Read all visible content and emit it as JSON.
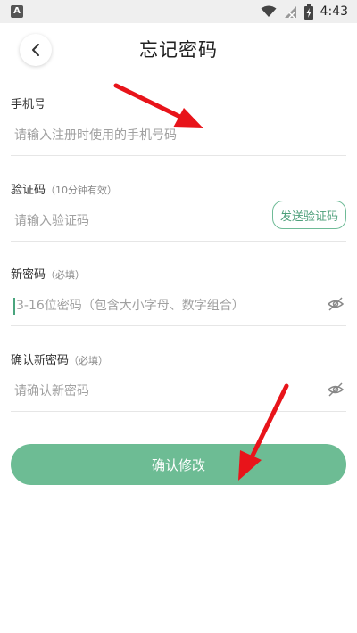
{
  "status_bar": {
    "app_icon_letter": "A",
    "time": "4:43",
    "icons": [
      "wifi-icon",
      "signal-off-icon",
      "battery-charging-icon"
    ]
  },
  "header": {
    "title": "忘记密码",
    "back_icon": "chevron-left-icon"
  },
  "form": {
    "phone": {
      "label": "手机号",
      "placeholder": "请输入注册时使用的手机号码"
    },
    "code": {
      "label": "验证码",
      "hint": "（10分钟有效）",
      "placeholder": "请输入验证码",
      "send_label": "发送验证码"
    },
    "new_password": {
      "label": "新密码",
      "hint": "（必填）",
      "placeholder": "3-16位密码（包含大小字母、数字组合）",
      "toggle_icon": "eye-off-icon"
    },
    "confirm_password": {
      "label": "确认新密码",
      "hint": "（必填）",
      "placeholder": "请确认新密码",
      "toggle_icon": "eye-off-icon"
    },
    "submit_label": "确认修改"
  },
  "colors": {
    "accent": "#6dbc94",
    "accent_text": "#4d9f7a",
    "annotation_arrow": "#e8141a"
  }
}
